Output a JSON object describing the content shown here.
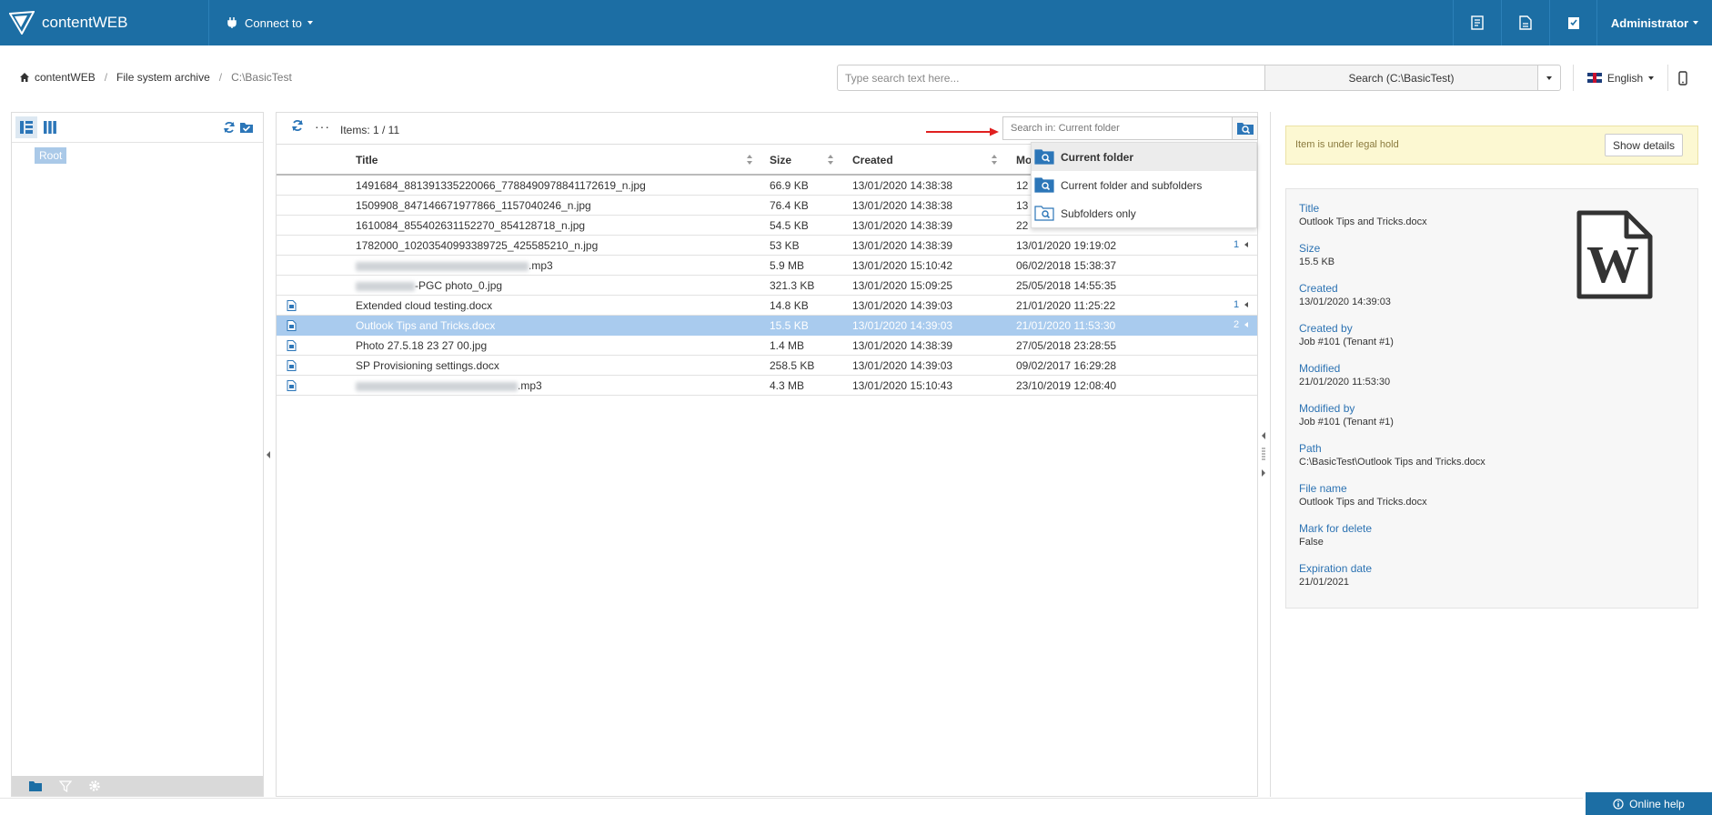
{
  "topbar": {
    "app_name": "contentWEB",
    "connect_label": "Connect to",
    "icons": [
      "report-icon",
      "document-icon",
      "checklist-icon"
    ],
    "user_label": "Administrator",
    "bg_color": "#1c6ea4"
  },
  "breadcrumb": {
    "home": "contentWEB",
    "section": "File system archive",
    "current": "C:\\BasicTest"
  },
  "search": {
    "placeholder": "Type search text here...",
    "button_label": "Search (C:\\BasicTest)"
  },
  "language": {
    "label": "English"
  },
  "tree": {
    "root_label": "Root"
  },
  "grid": {
    "items_count": "Items: 1 / 11",
    "more_label": "···",
    "search_placeholder": "Search in: Current folder",
    "columns": {
      "title": "Title",
      "size": "Size",
      "created": "Created",
      "modified": "Mo"
    },
    "rows": [
      {
        "title": "1491684_881391335220066_7788490978841172619_n.jpg",
        "size": "66.9 KB",
        "created": "13/01/2020 14:38:38",
        "modified": "12",
        "badge": "",
        "icon": false
      },
      {
        "title": "1509908_847146671977866_1157040246_n.jpg",
        "size": "76.4 KB",
        "created": "13/01/2020 14:38:38",
        "modified": "13",
        "badge": "",
        "icon": false
      },
      {
        "title": "1610084_855402631152270_854128718_n.jpg",
        "size": "54.5 KB",
        "created": "13/01/2020 14:38:39",
        "modified": "22",
        "badge": "",
        "icon": false
      },
      {
        "title": "1782000_10203540993389725_425585210_n.jpg",
        "size": "53 KB",
        "created": "13/01/2020 14:38:39",
        "modified": "13/01/2020 19:19:02",
        "badge": "1",
        "icon": false
      },
      {
        "title": ".mp3",
        "size": "5.9 MB",
        "created": "13/01/2020 15:10:42",
        "modified": "06/02/2018 15:38:37",
        "badge": "",
        "icon": false,
        "blur": 190
      },
      {
        "title": "-PGC photo_0.jpg",
        "size": "321.3 KB",
        "created": "13/01/2020 15:09:25",
        "modified": "25/05/2018 14:55:35",
        "badge": "",
        "icon": false,
        "blur": 65
      },
      {
        "title": "Extended cloud testing.docx",
        "size": "14.8 KB",
        "created": "13/01/2020 14:39:03",
        "modified": "21/01/2020 11:25:22",
        "badge": "1",
        "icon": true
      },
      {
        "title": "Outlook Tips and Tricks.docx",
        "size": "15.5 KB",
        "created": "13/01/2020 14:39:03",
        "modified": "21/01/2020 11:53:30",
        "badge": "2",
        "icon": true,
        "selected": true
      },
      {
        "title": "Photo 27.5.18 23 27 00.jpg",
        "size": "1.4 MB",
        "created": "13/01/2020 14:38:39",
        "modified": "27/05/2018 23:28:55",
        "badge": "",
        "icon": true
      },
      {
        "title": "SP Provisioning settings.docx",
        "size": "258.5 KB",
        "created": "13/01/2020 14:39:03",
        "modified": "09/02/2017 16:29:28",
        "badge": "",
        "icon": true
      },
      {
        "title": ".mp3",
        "size": "4.3 MB",
        "created": "13/01/2020 15:10:43",
        "modified": "23/10/2019 12:08:40",
        "badge": "",
        "icon": true,
        "blur": 178
      }
    ]
  },
  "search_scope_menu": {
    "items": [
      "Current folder",
      "Current folder and subfolders",
      "Subfolders only"
    ],
    "active_index": 0
  },
  "details": {
    "legal_hold_text": "Item is under legal hold",
    "show_details_label": "Show details",
    "properties": [
      {
        "label": "Title",
        "value": "Outlook Tips and Tricks.docx"
      },
      {
        "label": "Size",
        "value": "15.5 KB"
      },
      {
        "label": "Created",
        "value": "13/01/2020 14:39:03"
      },
      {
        "label": "Created by",
        "value": "Job #101 (Tenant #1)"
      },
      {
        "label": "Modified",
        "value": "21/01/2020 11:53:30"
      },
      {
        "label": "Modified by",
        "value": "Job #101 (Tenant #1)"
      },
      {
        "label": "Path",
        "value": "C:\\BasicTest\\Outlook Tips and Tricks.docx"
      },
      {
        "label": "File name",
        "value": "Outlook Tips and Tricks.docx"
      },
      {
        "label": "Mark for delete",
        "value": "False"
      },
      {
        "label": "Expiration date",
        "value": "21/01/2021"
      }
    ],
    "file_icon": "word-document-icon"
  },
  "footer": {
    "online_help_label": "Online help"
  }
}
